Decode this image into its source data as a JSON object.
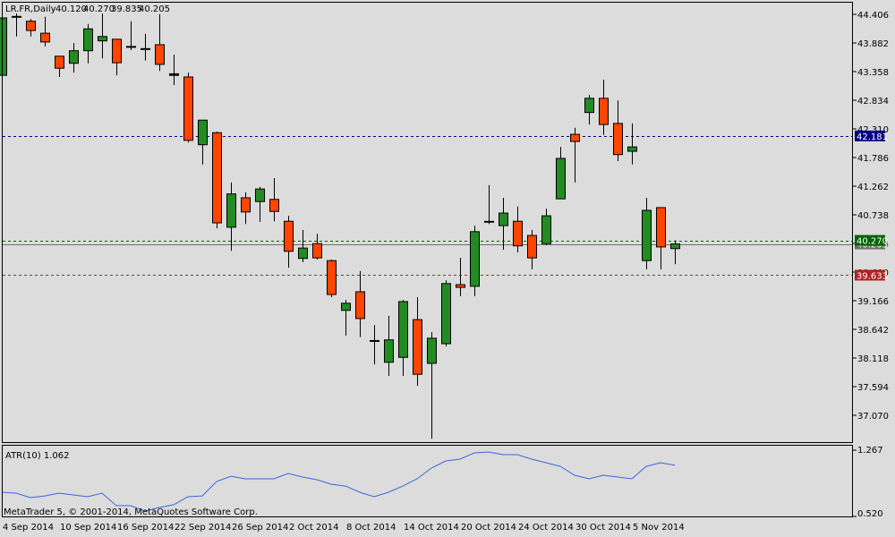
{
  "header": {
    "symbol": "LR.FR,Daily",
    "open": "40.120",
    "high": "40.270",
    "low": "39.835",
    "close": "40.205"
  },
  "indicator": {
    "label": "ATR(10) 1.062",
    "axis_top": "1.267",
    "axis_bottom": "0.520"
  },
  "copyright": "MetaTrader 5, © 2001-2014, MetaQuotes Software Corp.",
  "colors": {
    "bull": "#228b22",
    "bear": "#ff4500",
    "background": "#dcdcdc",
    "atr_line": "#3a66e0",
    "level_blue": "#000080",
    "level_green": "#006400",
    "level_red": "#b22222",
    "bid_gray": "#6e6e6e"
  },
  "levels": [
    {
      "name": "level-line-blue",
      "value": 42.181,
      "label": "42.181",
      "color": "#000080",
      "style": "dashed"
    },
    {
      "name": "ask-line",
      "value": 40.27,
      "label": "40.270",
      "color": "#006400",
      "style": "dashed"
    },
    {
      "name": "bid-line",
      "value": 40.205,
      "label": "40.205",
      "color": "#6e6e6e",
      "style": "solid"
    },
    {
      "name": "level-line-red",
      "value": 39.633,
      "label": "39.633",
      "color": "#b22222",
      "style": "dashed"
    }
  ],
  "time_labels": [
    {
      "label": "4 Sep 2014",
      "index": 0
    },
    {
      "label": "10 Sep 2014",
      "index": 4
    },
    {
      "label": "16 Sep 2014",
      "index": 8
    },
    {
      "label": "22 Sep 2014",
      "index": 12
    },
    {
      "label": "26 Sep 2014",
      "index": 16
    },
    {
      "label": "2 Oct 2014",
      "index": 20
    },
    {
      "label": "8 Oct 2014",
      "index": 24
    },
    {
      "label": "14 Oct 2014",
      "index": 28
    },
    {
      "label": "20 Oct 2014",
      "index": 32
    },
    {
      "label": "24 Oct 2014",
      "index": 36
    },
    {
      "label": "30 Oct 2014",
      "index": 40
    },
    {
      "label": "5 Nov 2014",
      "index": 44
    }
  ],
  "chart_data": {
    "type": "candlestick",
    "title": "LR.FR,Daily",
    "ylim": [
      36.6,
      44.65
    ],
    "yticks": [
      "44.406",
      "43.882",
      "43.358",
      "42.834",
      "42.310",
      "41.786",
      "41.262",
      "40.738",
      "40.214",
      "39.690",
      "39.166",
      "38.642",
      "38.118",
      "37.594",
      "37.070"
    ],
    "ohlc": [
      [
        43.29,
        44.39,
        43.29,
        44.34
      ],
      [
        44.36,
        44.42,
        44.0,
        44.35
      ],
      [
        44.28,
        44.32,
        44.0,
        44.11
      ],
      [
        44.06,
        44.36,
        43.82,
        43.9
      ],
      [
        43.64,
        43.64,
        43.26,
        43.42
      ],
      [
        43.51,
        43.88,
        43.34,
        43.74
      ],
      [
        43.74,
        44.23,
        43.51,
        44.14
      ],
      [
        43.92,
        44.42,
        43.6,
        44.0
      ],
      [
        43.95,
        43.95,
        43.29,
        43.52
      ],
      [
        43.81,
        44.28,
        43.75,
        43.8
      ],
      [
        43.77,
        44.05,
        43.56,
        43.76
      ],
      [
        43.85,
        44.41,
        43.37,
        43.49
      ],
      [
        43.28,
        43.67,
        43.11,
        43.31
      ],
      [
        43.26,
        43.34,
        42.06,
        42.1
      ],
      [
        42.02,
        42.47,
        41.66,
        42.47
      ],
      [
        42.24,
        42.26,
        40.49,
        40.59
      ],
      [
        40.51,
        41.33,
        40.08,
        41.12
      ],
      [
        41.05,
        41.15,
        40.57,
        40.79
      ],
      [
        40.98,
        41.25,
        40.61,
        41.21
      ],
      [
        41.02,
        41.41,
        40.62,
        40.8
      ],
      [
        40.62,
        40.72,
        39.77,
        40.07
      ],
      [
        39.94,
        40.46,
        39.87,
        40.13
      ],
      [
        40.21,
        40.39,
        39.92,
        39.95
      ],
      [
        39.9,
        39.92,
        39.23,
        39.28
      ],
      [
        38.99,
        39.18,
        38.53,
        39.12
      ],
      [
        39.33,
        39.71,
        38.5,
        38.84
      ],
      [
        38.43,
        38.72,
        38.0,
        38.42
      ],
      [
        38.04,
        38.89,
        37.79,
        38.45
      ],
      [
        38.13,
        39.18,
        37.79,
        39.15
      ],
      [
        38.82,
        39.23,
        37.61,
        37.82
      ],
      [
        38.02,
        38.59,
        36.64,
        38.48
      ],
      [
        38.38,
        39.54,
        38.33,
        39.48
      ],
      [
        39.46,
        39.95,
        39.25,
        39.41
      ],
      [
        39.43,
        40.54,
        39.25,
        40.43
      ],
      [
        40.61,
        41.28,
        40.57,
        40.6
      ],
      [
        40.54,
        41.05,
        40.1,
        40.77
      ],
      [
        40.62,
        40.89,
        40.05,
        40.17
      ],
      [
        40.36,
        40.46,
        39.74,
        39.95
      ],
      [
        40.21,
        40.85,
        40.18,
        40.72
      ],
      [
        41.03,
        41.98,
        41.03,
        41.77
      ],
      [
        42.21,
        42.33,
        41.33,
        42.08
      ],
      [
        42.61,
        42.93,
        42.39,
        42.87
      ],
      [
        42.87,
        43.21,
        42.2,
        42.39
      ],
      [
        42.41,
        42.83,
        41.72,
        41.84
      ],
      [
        41.9,
        42.41,
        41.66,
        41.98
      ],
      [
        39.9,
        41.05,
        39.74,
        40.82
      ],
      [
        40.87,
        40.87,
        39.74,
        40.15
      ],
      [
        40.12,
        40.27,
        39.835,
        40.205
      ]
    ],
    "atr": {
      "name": "ATR(10)",
      "ylim": [
        0.52,
        1.267
      ],
      "values": [
        0.775,
        0.766,
        0.719,
        0.737,
        0.766,
        0.747,
        0.728,
        0.766,
        0.633,
        0.633,
        0.577,
        0.615,
        0.643,
        0.728,
        0.737,
        0.889,
        0.945,
        0.917,
        0.917,
        0.917,
        0.974,
        0.936,
        0.908,
        0.86,
        0.841,
        0.775,
        0.728,
        0.775,
        0.841,
        0.917,
        1.031,
        1.106,
        1.125,
        1.191,
        1.201,
        1.172,
        1.172,
        1.125,
        1.087,
        1.049,
        0.955,
        0.917,
        0.955,
        0.936,
        0.917,
        1.049,
        1.087,
        1.062
      ]
    }
  }
}
